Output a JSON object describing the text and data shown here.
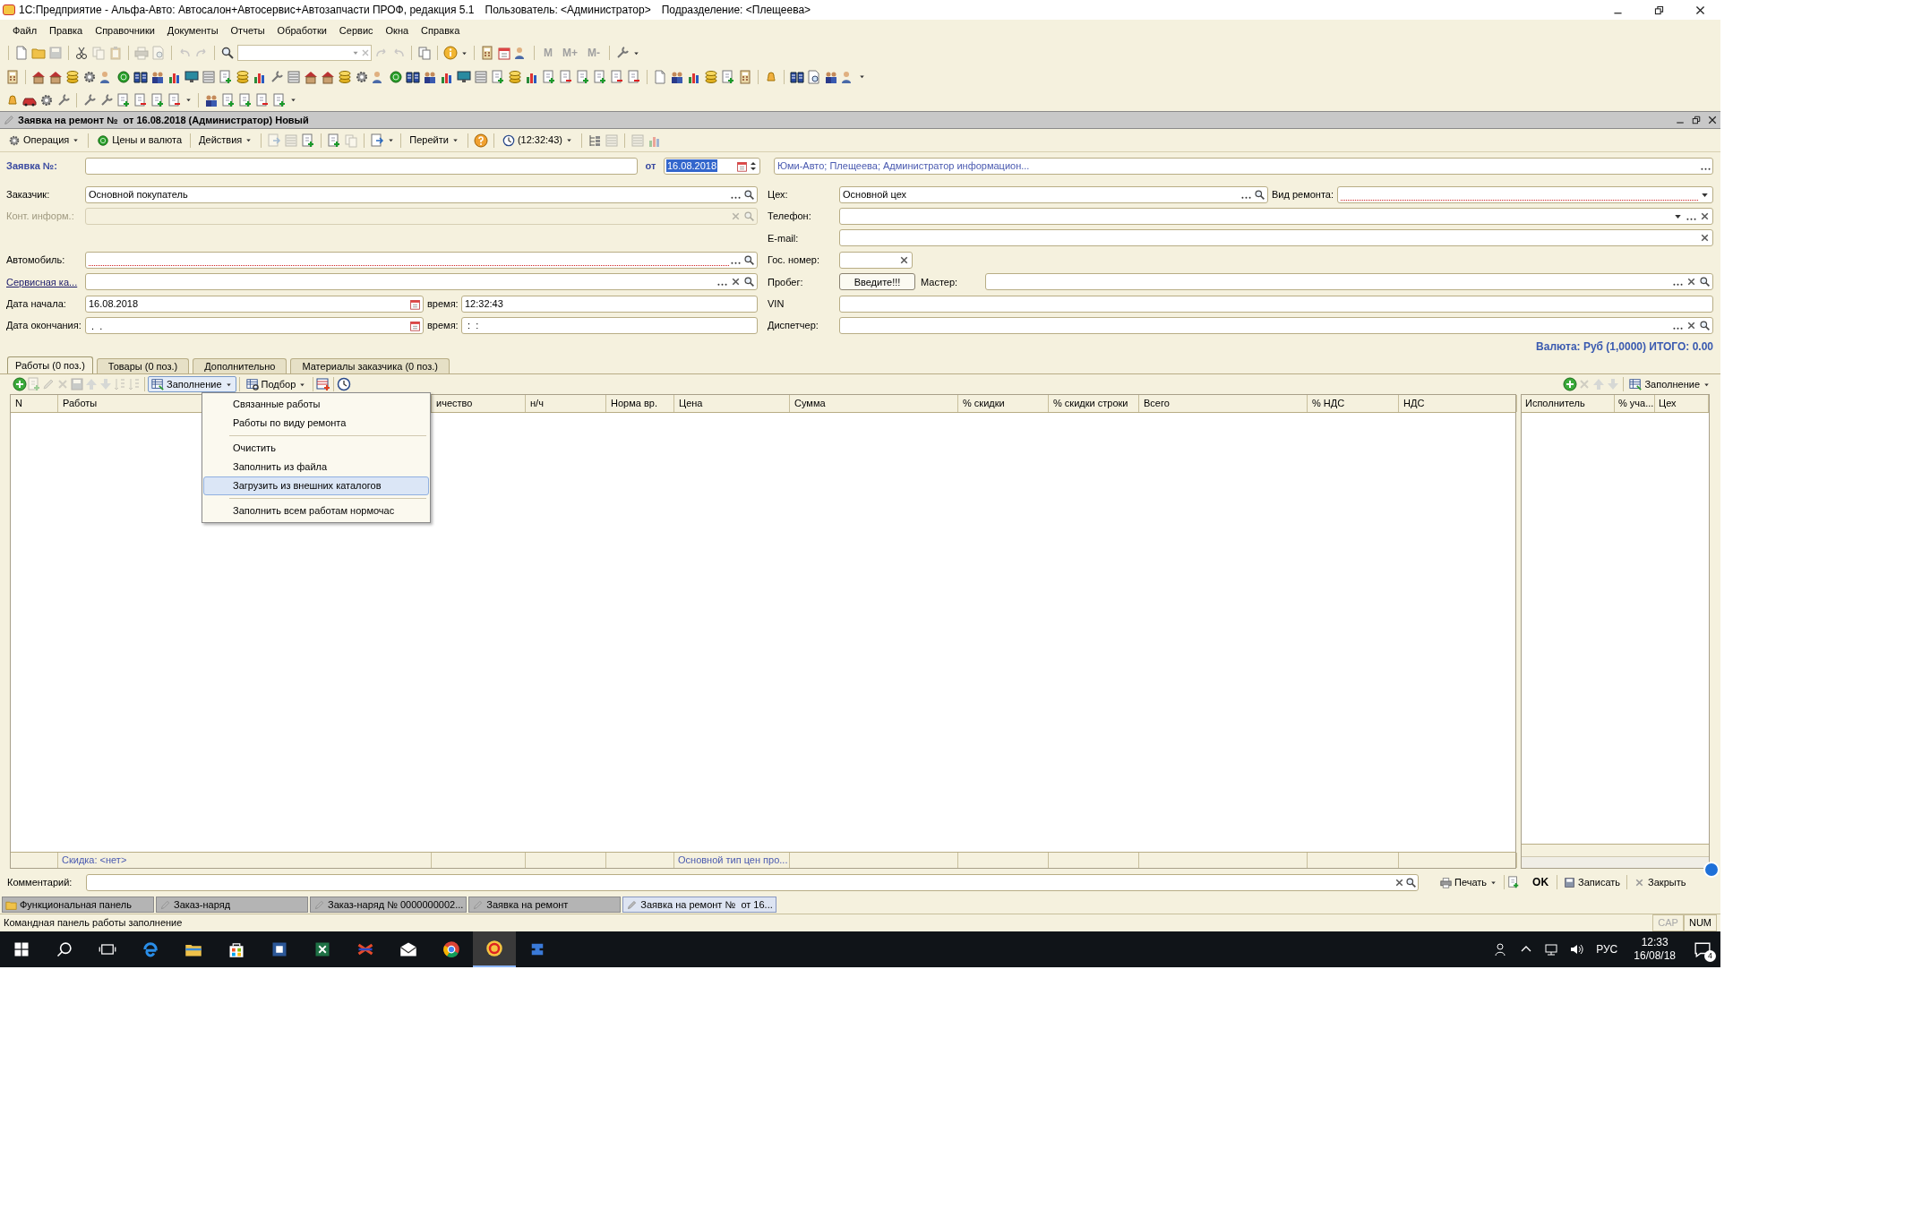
{
  "window": {
    "title": "1С:Предприятие - Альфа-Авто: Автосалон+Автосервис+Автозапчасти ПРОФ, редакция 5.1",
    "user": "Пользователь: <Администратор>",
    "division": "Подразделение: <Плещеева>"
  },
  "menu": [
    "Файл",
    "Правка",
    "Справочники",
    "Документы",
    "Отчеты",
    "Обработки",
    "Сервис",
    "Окна",
    "Справка"
  ],
  "toolbar": {
    "memory_buttons": [
      "M",
      "M+",
      "M-"
    ]
  },
  "document": {
    "title": "Заявка на ремонт №  от 16.08.2018 (Администратор) Новый",
    "toolbar": [
      {
        "label": "Операция",
        "dropdown": true
      },
      {
        "label": "Цены и валюта",
        "dropdown": false
      },
      {
        "label": "Действия",
        "dropdown": true
      },
      {
        "label": "Перейти",
        "dropdown": true
      },
      {
        "label": "(12:32:43)",
        "dropdown": true
      }
    ],
    "header": {
      "number_label": "Заявка №:",
      "date_label": "от",
      "date_value": "16.08.2018",
      "info": "Юми-Авто; Плещеева; Администратор информацион..."
    },
    "rows": [
      {
        "left": {
          "label": "Заказчик:",
          "link": false,
          "value": "Основной покупатель",
          "select_button": true,
          "search_button": true,
          "required": false,
          "disabled": false
        },
        "right": [
          {
            "kind": "wide",
            "label": "Цех:",
            "link": false,
            "value": "Основной цех",
            "select_button": true,
            "search_button": true,
            "required": false,
            "disabled": false
          },
          {
            "kind": "grow",
            "label": "Вид ремонта:",
            "link": false,
            "dropdown_button": true,
            "required": true,
            "disabled": false
          }
        ]
      },
      {
        "left": {
          "label": "Конт. информ.:",
          "link": false,
          "clear_button": true,
          "search_button": true,
          "required": false,
          "disabled": true
        },
        "right": [
          {
            "kind": "grow",
            "label": "Телефон:",
            "link": false,
            "dropdown_button": true,
            "select_button": true,
            "clear_button": true,
            "required": false,
            "disabled": false
          }
        ]
      },
      {
        "right": [
          {
            "kind": "grow",
            "label": "E-mail:",
            "link": false,
            "clear_button": true,
            "required": false,
            "disabled": false
          }
        ]
      },
      {
        "left": {
          "label": "Автомобиль:",
          "link": false,
          "select_button": true,
          "search_button": true,
          "required": true,
          "disabled": false
        },
        "right": [
          {
            "kind": "short",
            "label": "Гос. номер:",
            "link": false,
            "clear_button": true,
            "required": false,
            "disabled": false
          }
        ]
      },
      {
        "left": {
          "label": "Сервисная ка...",
          "link": true,
          "select_button": true,
          "clear_button": true,
          "search_button": true,
          "required": false,
          "disabled": false
        },
        "right": [
          {
            "kind": "button",
            "label": "Пробег:",
            "link": false,
            "value": "Введите!!!"
          },
          {
            "kind": "grow",
            "label": "Мастер:",
            "link": false,
            "select_button": true,
            "clear_button": true,
            "search_button": true,
            "required": false,
            "disabled": false
          }
        ]
      },
      {
        "left": {
          "label": "Дата начала:",
          "link": false,
          "value": "16.08.2018",
          "calendar_button": true,
          "required": false,
          "disabled": false,
          "time_label": "время:",
          "time_value": "12:32:43"
        },
        "right": [
          {
            "kind": "grow",
            "label": "VIN",
            "link": false,
            "required": false,
            "disabled": false
          }
        ]
      },
      {
        "left": {
          "label": "Дата окончания:",
          "link": false,
          "value": " .  .",
          "calendar_button": true,
          "required": false,
          "disabled": false,
          "time_label": "время:",
          "time_value": " :  :"
        },
        "right": [
          {
            "kind": "grow",
            "label": "Диспетчер:",
            "link": false,
            "select_button": true,
            "clear_button": true,
            "search_button": true,
            "required": false,
            "disabled": false
          }
        ]
      }
    ],
    "total": "Валюта: Руб (1,0000) ИТОГО: 0.00"
  },
  "tabs": [
    {
      "label": "Работы (0 поз.)",
      "selected": true
    },
    {
      "label": "Товары (0 поз.)",
      "selected": false
    },
    {
      "label": "Дополнительно",
      "selected": false
    },
    {
      "label": "Материалы заказчика (0 поз.)",
      "selected": false
    }
  ],
  "table_toolbar": [
    {
      "label": "Заполнение",
      "pressed": true
    },
    {
      "label": "Подбор",
      "pressed": false
    }
  ],
  "table": {
    "columns": [
      "N",
      "Работы",
      "ичество",
      "н/ч",
      "Норма вр.",
      "Цена",
      "Сумма",
      "% скидки",
      "% скидки строки",
      "Всего",
      "% НДС",
      "НДС"
    ],
    "footer": {
      "discount": "Скидка: <нет>",
      "price_type": "Основной тип цен про..."
    }
  },
  "fill_menu": [
    {
      "kind": "item",
      "label": "Связанные работы",
      "selected": false
    },
    {
      "kind": "item",
      "label": "Работы по виду ремонта",
      "selected": false
    },
    {
      "kind": "separator"
    },
    {
      "kind": "item",
      "label": "Очистить",
      "selected": false
    },
    {
      "kind": "item",
      "label": "Заполнить из файла",
      "selected": false
    },
    {
      "kind": "item",
      "label": "Загрузить из внешних каталогов",
      "selected": true
    },
    {
      "kind": "separator"
    },
    {
      "kind": "item",
      "label": "Заполнить всем работам нормочас",
      "selected": false
    }
  ],
  "side_table": {
    "toolbar_button": "Заполнение",
    "columns": [
      "Исполнитель",
      "% уча...",
      "Цех"
    ]
  },
  "comment": {
    "label": "Комментарий:"
  },
  "bottom_buttons": [
    {
      "kind": "print",
      "label": "Печать"
    },
    {
      "kind": "ok",
      "label": "OK"
    },
    {
      "kind": "save",
      "label": "Записать"
    },
    {
      "kind": "close",
      "label": "Закрыть"
    }
  ],
  "window_tabs": [
    {
      "label": "Функциональная панель",
      "selected": false
    },
    {
      "label": "Заказ-наряд",
      "selected": false
    },
    {
      "label": "Заказ-наряд № 0000000002...",
      "selected": false
    },
    {
      "label": "Заявка на ремонт",
      "selected": false
    },
    {
      "label": "Заявка на ремонт №  от 16...",
      "selected": true
    }
  ],
  "status": {
    "text": "Командная панель работы заполнение",
    "indicators": [
      {
        "label": "CAP",
        "on": false
      },
      {
        "label": "NUM",
        "on": true
      }
    ]
  },
  "taskbar": {
    "language": "РУС",
    "time": "12:33",
    "date": "16/08/18",
    "notifications": "4"
  }
}
